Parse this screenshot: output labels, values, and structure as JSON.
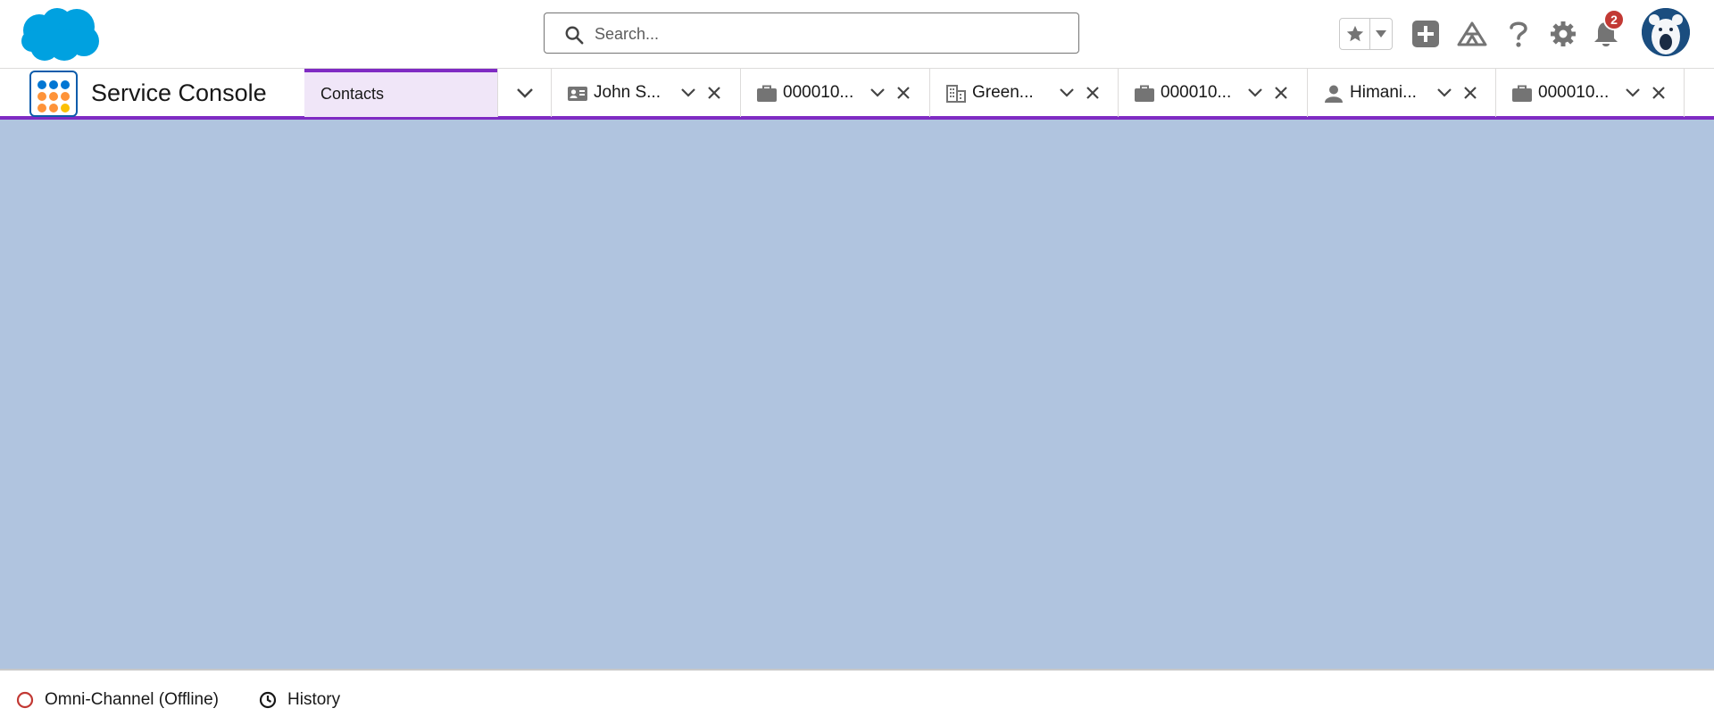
{
  "header": {
    "search": {
      "placeholder": "Search..."
    },
    "notifications": {
      "count": "2"
    },
    "icons": [
      "favorites-star-icon",
      "favorites-caret-icon",
      "global-create-icon",
      "trailhead-icon",
      "help-icon",
      "setup-gear-icon",
      "notifications-bell-icon",
      "avatar"
    ]
  },
  "nav": {
    "app_name": "Service Console",
    "main_tab": {
      "label": "Contacts"
    },
    "subtabs": [
      {
        "label": "John S...",
        "icon": "contact-card-icon"
      },
      {
        "label": "000010...",
        "icon": "case-briefcase-icon"
      },
      {
        "label": "Green...",
        "icon": "account-building-icon"
      },
      {
        "label": "000010...",
        "icon": "case-briefcase-icon"
      },
      {
        "label": "Himani...",
        "icon": "person-icon"
      },
      {
        "label": "000010...",
        "icon": "case-briefcase-icon"
      }
    ]
  },
  "utility_bar": {
    "items": [
      {
        "label": "Omni-Channel (Offline)",
        "icon": "offline-status-icon"
      },
      {
        "label": "History",
        "icon": "clock-icon"
      }
    ]
  },
  "colors": {
    "brand_blue": "#00a1e0",
    "nav_accent": "#7f2bc3",
    "workspace_bg": "#b0c4df",
    "badge_red": "#c23934",
    "icon_gray": "#747474"
  }
}
